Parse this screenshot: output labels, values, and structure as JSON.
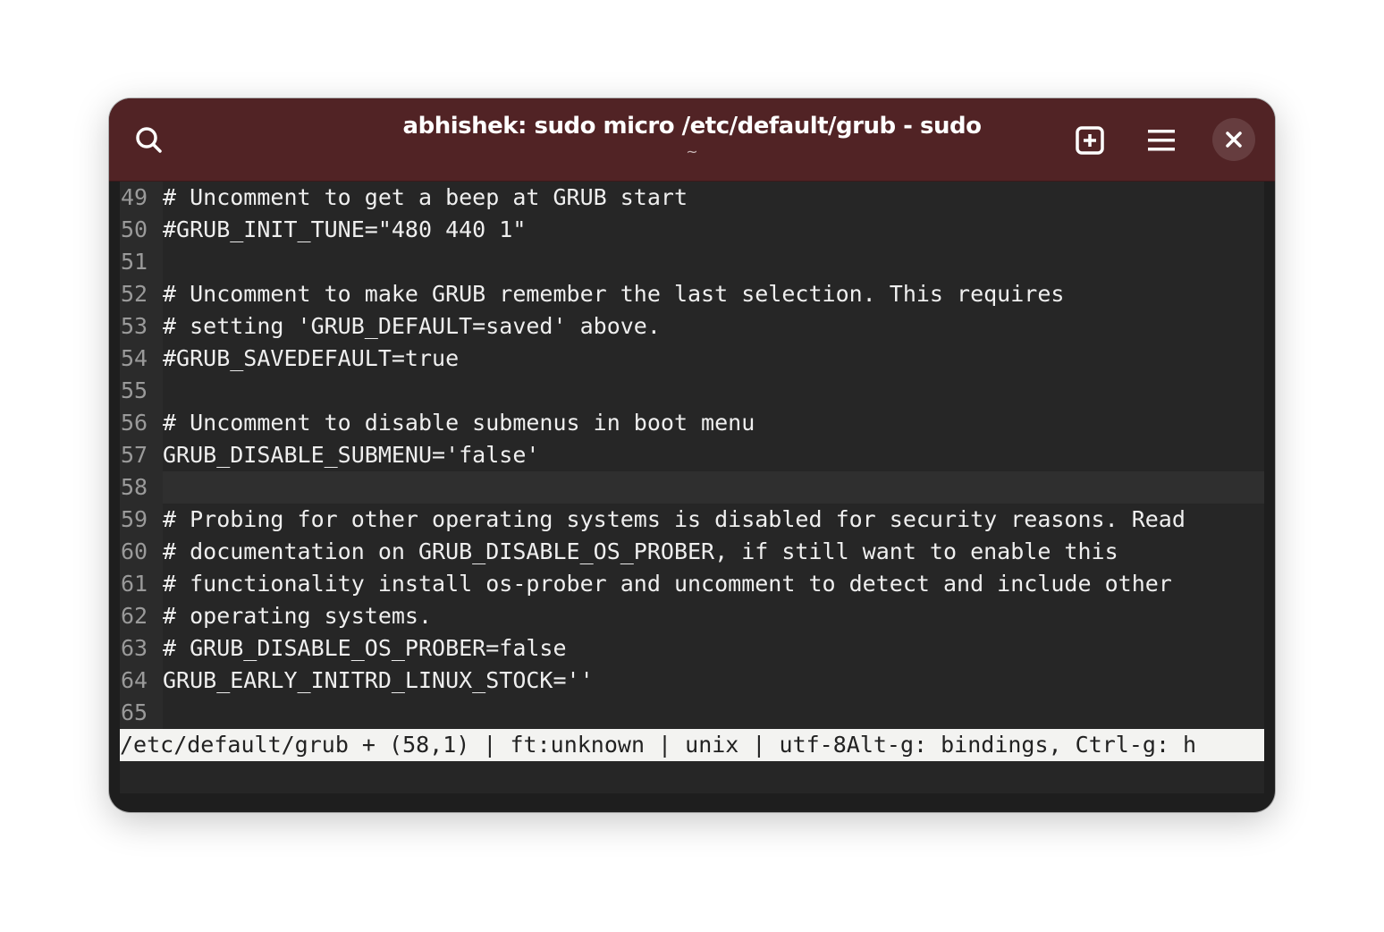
{
  "window": {
    "title": "abhishek: sudo micro /etc/default/grub - sudo",
    "subtitle": "~",
    "titlebar_color": "#512325"
  },
  "toolbar": {
    "search_icon": "search-icon",
    "new_tab_icon": "new-tab-icon",
    "menu_icon": "hamburger-menu-icon",
    "close_icon": "close-icon"
  },
  "editor": {
    "current_line": 58,
    "lines": [
      {
        "num": "49",
        "text": "# Uncomment to get a beep at GRUB start"
      },
      {
        "num": "50",
        "text": "#GRUB_INIT_TUNE=\"480 440 1\""
      },
      {
        "num": "51",
        "text": ""
      },
      {
        "num": "52",
        "text": "# Uncomment to make GRUB remember the last selection. This requires"
      },
      {
        "num": "53",
        "text": "# setting 'GRUB_DEFAULT=saved' above."
      },
      {
        "num": "54",
        "text": "#GRUB_SAVEDEFAULT=true"
      },
      {
        "num": "55",
        "text": ""
      },
      {
        "num": "56",
        "text": "# Uncomment to disable submenus in boot menu"
      },
      {
        "num": "57",
        "text": "GRUB_DISABLE_SUBMENU='false'"
      },
      {
        "num": "58",
        "text": ""
      },
      {
        "num": "59",
        "text": "# Probing for other operating systems is disabled for security reasons. Read"
      },
      {
        "num": "60",
        "text": "# documentation on GRUB_DISABLE_OS_PROBER, if still want to enable this"
      },
      {
        "num": "61",
        "text": "# functionality install os-prober and uncomment to detect and include other"
      },
      {
        "num": "62",
        "text": "# operating systems."
      },
      {
        "num": "63",
        "text": "# GRUB_DISABLE_OS_PROBER=false"
      },
      {
        "num": "64",
        "text": "GRUB_EARLY_INITRD_LINUX_STOCK=''"
      },
      {
        "num": "65",
        "text": ""
      }
    ]
  },
  "statusbar": {
    "text": "/etc/default/grub + (58,1) | ft:unknown | unix | utf-8Alt-g: bindings, Ctrl-g: h"
  }
}
